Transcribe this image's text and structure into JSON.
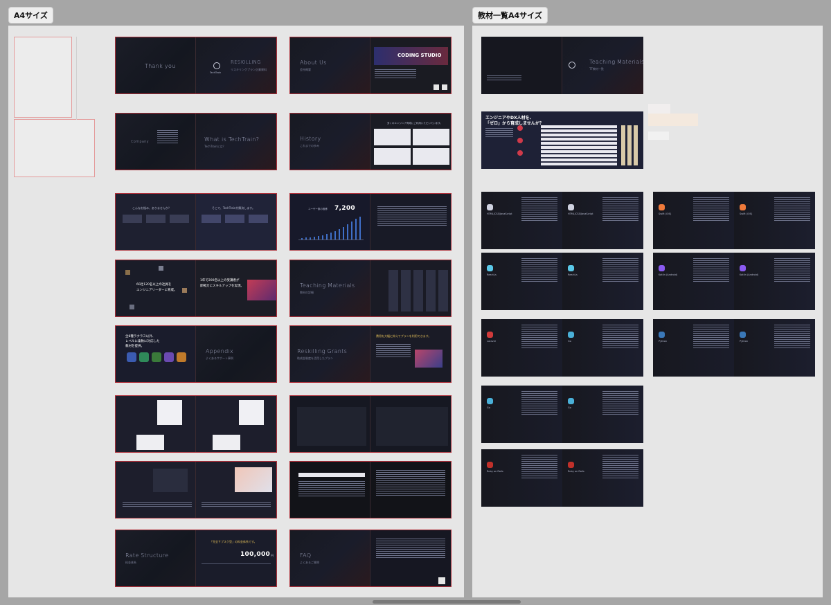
{
  "sections": {
    "a4": {
      "label": "A4サイズ"
    },
    "materials": {
      "label": "教材一覧A4サイズ"
    }
  },
  "slides": {
    "thankyou": {
      "title": "Thank you",
      "brand": "RESKILLING",
      "brand_sub": "リスキリングプラン企業資料",
      "logo_name": "TechTrain"
    },
    "about": {
      "title": "About Us",
      "sub": "会社概要",
      "banner": "CODING STUDIO"
    },
    "company": {
      "title": "Company"
    },
    "whatis": {
      "title": "What is TechTrain?",
      "sub": "TechTrainとは？"
    },
    "history": {
      "title": "History",
      "sub": "これまでの歩み"
    },
    "history_right": {
      "heading": "多くのエンジニア育成にご利用いただいています。"
    },
    "problem_a": {
      "heading": "こんなお悩み、ありませんか？"
    },
    "problem_b": {
      "heading": "そこで、TechTrainが解決します。"
    },
    "users": {
      "headline": "7,200",
      "caption": "ユーザー数の推移"
    },
    "engineers": {
      "line1": "60社120名以上の社員を",
      "line2": "エンジニアリーダーに育成。"
    },
    "growth": {
      "line1": "1年で200名以上の受講者が",
      "line2": "即戦力にスキルアップを実現。"
    },
    "teaching": {
      "title": "Teaching Materials",
      "sub": "教材の詳細"
    },
    "course": {
      "line1": "全8種ラクラス以外、",
      "line2": "レベルに柔軟に対応した",
      "line3": "教材を提供。"
    },
    "appendix": {
      "title": "Appendix",
      "sub": "よくあるサポート事例"
    },
    "grants": {
      "title": "Reskilling Grants",
      "sub": "助成金制度を活用したプラン"
    },
    "grants_right": {
      "heading": "費用を大幅に抑えてプランを利用できます。"
    },
    "rate": {
      "title": "Rate Structure",
      "sub": "料金体系",
      "price": "100,000",
      "price_unit": "円",
      "headline": "「完全サブスク型」の料金体系です。"
    },
    "faq": {
      "title": "FAQ",
      "sub": "よくあるご質問"
    }
  },
  "materials": {
    "cover": {
      "title": "Teaching Materials",
      "sub": "TT教材一覧"
    },
    "banner": {
      "line1": "エンジニアやDX人材を、",
      "line2": "「ゼロ」から育成しませんか？"
    },
    "cards": [
      {
        "name": "HTML/CSS/JavaScript",
        "icon": "code-icon"
      },
      {
        "name": "HTML/CSS/JavaScript",
        "icon": "code-icon"
      },
      {
        "name": "Swift (iOS)",
        "icon": "swift-icon"
      },
      {
        "name": "Swift (iOS)",
        "icon": "swift-icon"
      },
      {
        "name": "React.js",
        "icon": "react-icon"
      },
      {
        "name": "React.js",
        "icon": "react-icon"
      },
      {
        "name": "Kotlin (Android)",
        "icon": "kotlin-icon"
      },
      {
        "name": "Kotlin (Android)",
        "icon": "kotlin-icon"
      },
      {
        "name": "Laravel",
        "icon": "laravel-icon"
      },
      {
        "name": "Go",
        "icon": "go-icon"
      },
      {
        "name": "Python",
        "icon": "python-icon"
      },
      {
        "name": "Python",
        "icon": "python-icon"
      },
      {
        "name": "Go",
        "icon": "go-icon"
      },
      {
        "name": "Go",
        "icon": "go-icon"
      },
      {
        "name": "Ruby on Rails",
        "icon": "rails-icon"
      },
      {
        "name": "Ruby on Rails",
        "icon": "rails-icon"
      }
    ]
  },
  "colors": {
    "canvas": "#a6a6a6",
    "section": "#e6e6e6",
    "slide_bg": "#15161c",
    "highlight": "#b0303a",
    "accent_blue": "#3f6fc8"
  }
}
